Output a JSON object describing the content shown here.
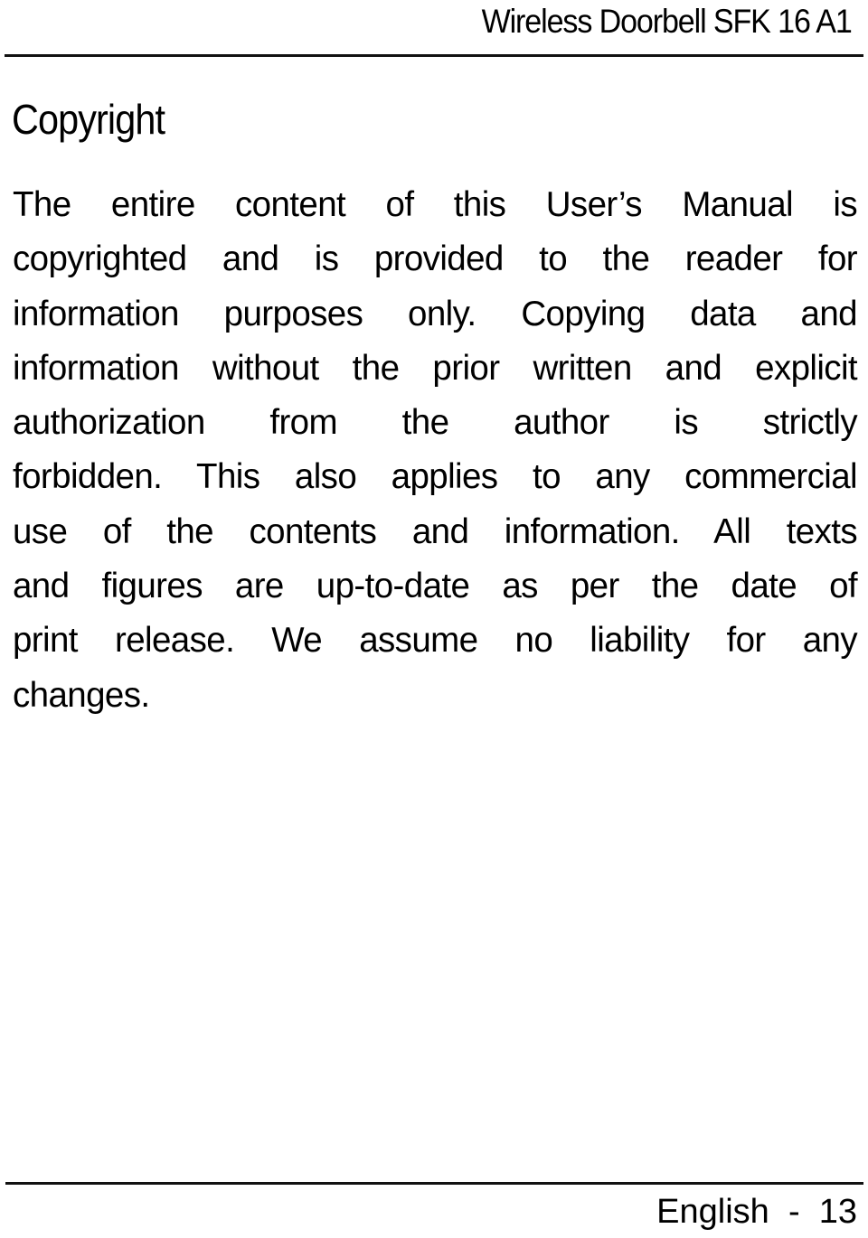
{
  "header": {
    "title": "Wireless Doorbell SFK 16 A1"
  },
  "section": {
    "title": "Copyright",
    "lines": [
      "The entire content of this User’s Manual is",
      "copyrighted and is provided to the reader for",
      "information purposes only. Copying data and",
      "information without the prior written and explicit",
      "authorization from the author is strictly",
      "forbidden. This also applies to any commercial",
      "use of the contents and information. All texts",
      "and figures are up-to-date as per the date of",
      "print release. We assume no liability for any",
      "changes."
    ]
  },
  "footer": {
    "language": "English",
    "separator": "-",
    "page_number": "13"
  }
}
